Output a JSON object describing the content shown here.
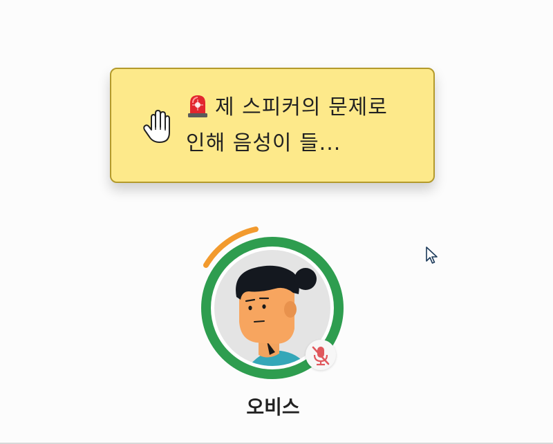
{
  "message": {
    "text": "제 스피커의 문제로 인해 음성이 들...",
    "leading_icon": "raised-hand-icon",
    "emoji_icon": "police-siren-icon"
  },
  "participant": {
    "name": "오비스",
    "avatar": "avatar-illustration",
    "speaking_ring_color": "#2e9d4f",
    "activity_arc_color": "#f29a2e",
    "status_icon": "mic-off-icon"
  },
  "colors": {
    "bubble_bg": "#fde98a",
    "bubble_border": "#b39a2b",
    "mic_off": "#e0585d"
  }
}
